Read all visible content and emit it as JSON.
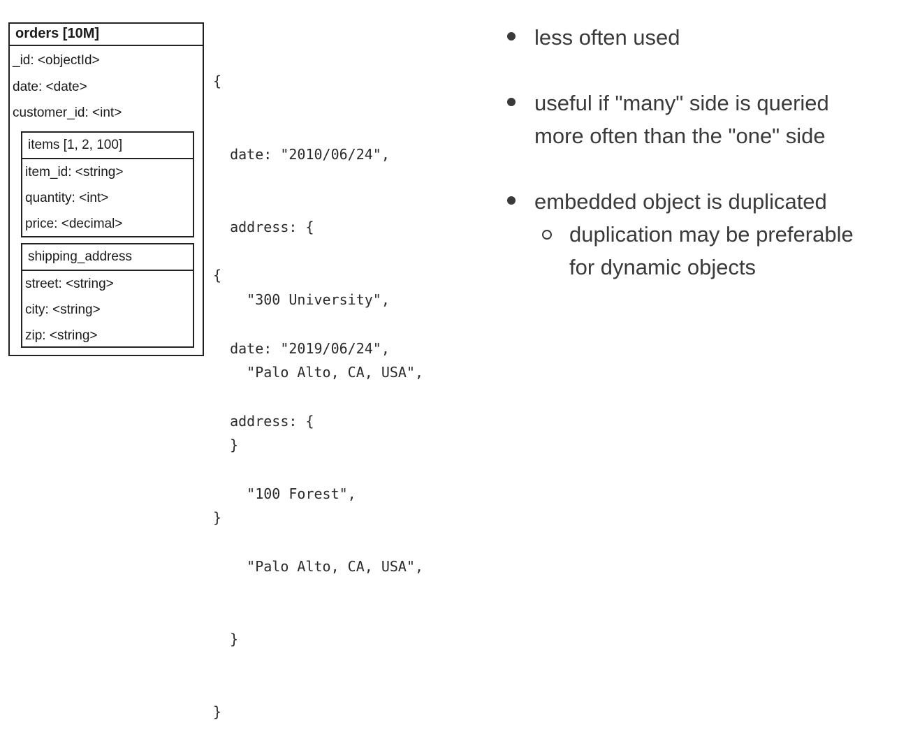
{
  "schema": {
    "title": "orders [10M]",
    "fields": [
      "_id: <objectId>",
      "date: <date>",
      "customer_id: <int>"
    ],
    "items": {
      "title": "items [1, 2, 100]",
      "fields": [
        "item_id: <string>",
        "quantity: <int>",
        "price: <decimal>"
      ]
    },
    "shipping": {
      "title": "shipping_address",
      "fields": [
        "street: <string>",
        "city: <string>",
        "zip: <string>"
      ]
    }
  },
  "code_samples": [
    {
      "lines": [
        "{",
        "  date: \"2010/06/24\",",
        "  address: {",
        "    \"300 University\",",
        "    \"Palo Alto, CA, USA\",",
        "  }",
        "}"
      ]
    },
    {
      "lines": [
        "{",
        "  date: \"2019/06/24\",",
        "  address: {",
        "    \"100 Forest\",",
        "    \"Palo Alto, CA, USA\",",
        "  }",
        "}"
      ]
    }
  ],
  "bullets": [
    {
      "lines": [
        "less often used"
      ]
    },
    {
      "lines": [
        "useful if \"many\" side is queried",
        "more often than the \"one\" side"
      ]
    },
    {
      "lines": [
        "embedded object is duplicated"
      ],
      "sub": {
        "lines": [
          "duplication may be preferable",
          "for dynamic objects"
        ]
      }
    }
  ]
}
